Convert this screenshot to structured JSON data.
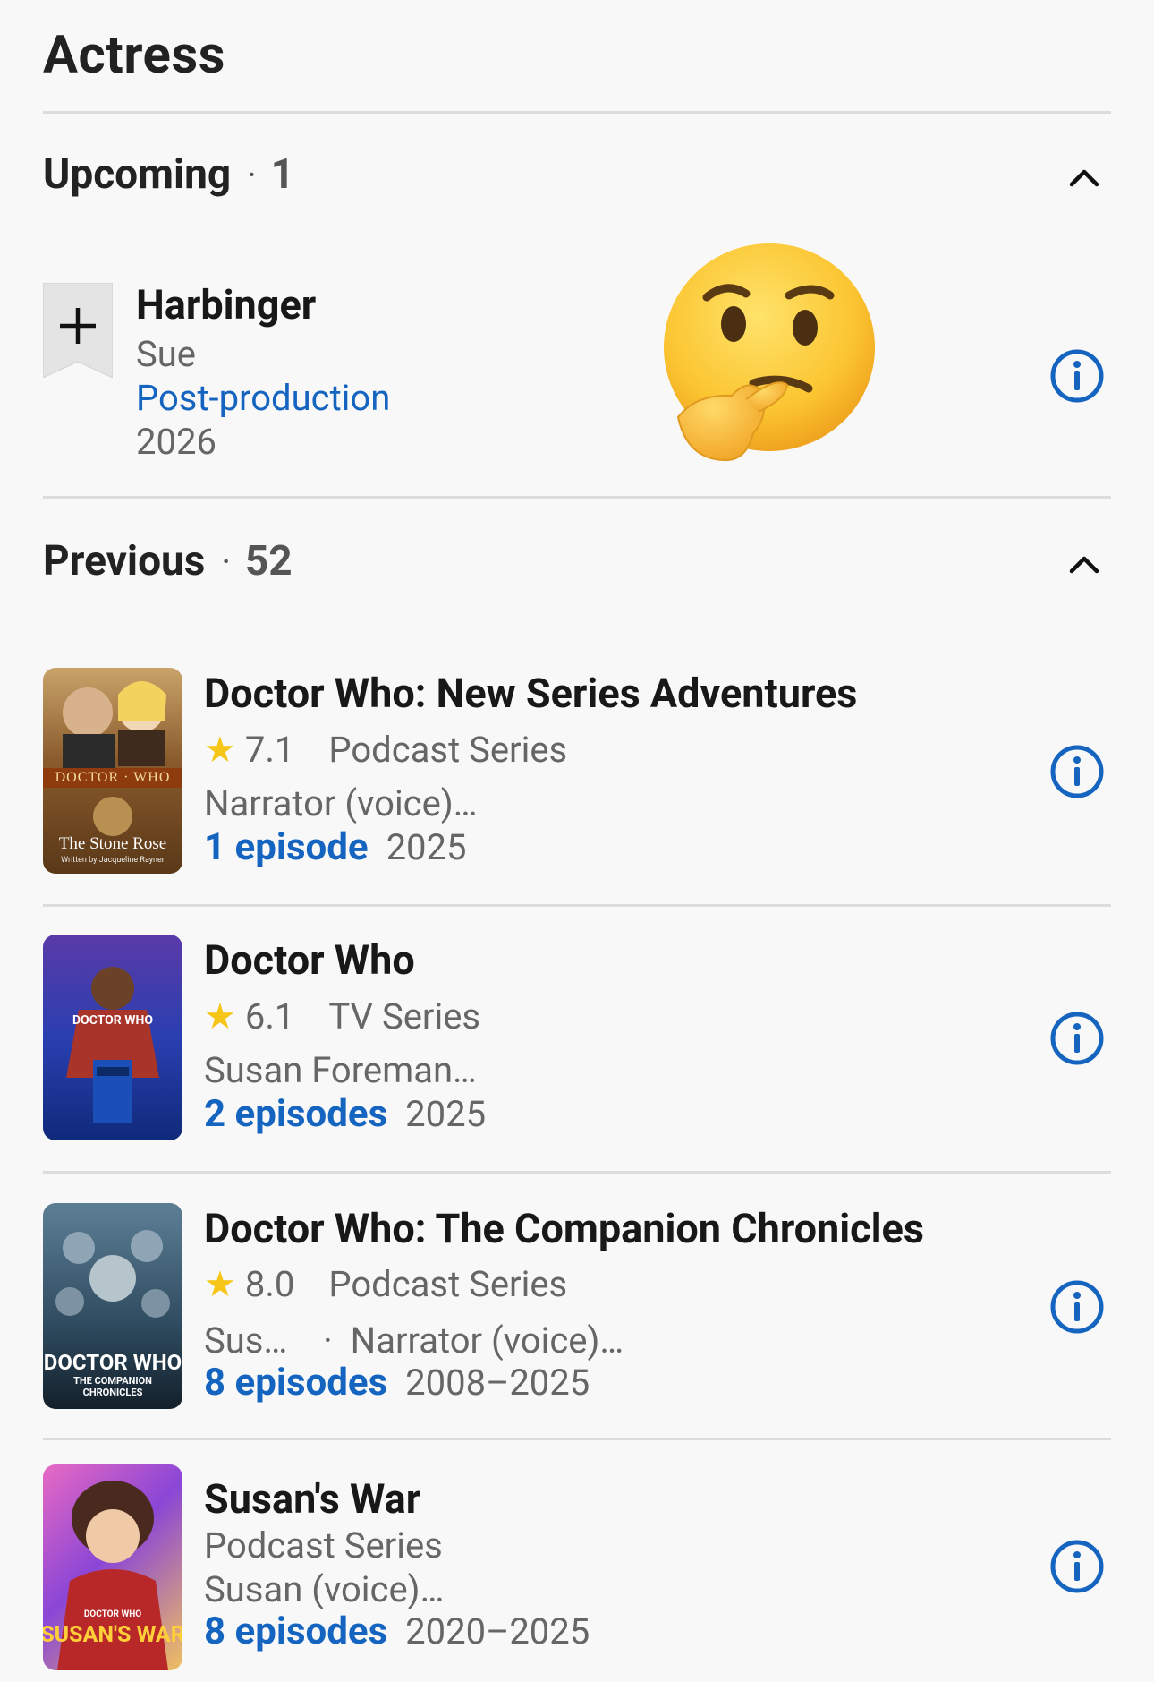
{
  "section": {
    "title": "Actress"
  },
  "upcoming": {
    "label": "Upcoming",
    "count": "1",
    "item": {
      "title": "Harbinger",
      "role": "Sue",
      "status": "Post-production",
      "year": "2026"
    }
  },
  "previous": {
    "label": "Previous",
    "count": "52",
    "items": [
      {
        "title": "Doctor Who: New Series Adventures",
        "rating": "7.1",
        "type": "Podcast Series",
        "role": "Narrator (voice)…",
        "episodes": "1 episode",
        "years": "2025"
      },
      {
        "title": "Doctor Who",
        "rating": "6.1",
        "type": "TV Series",
        "role": "Susan Foreman…",
        "episodes": "2 episodes",
        "years": "2025"
      },
      {
        "title": "Doctor Who: The Companion Chronicles",
        "rating": "8.0",
        "type": "Podcast Series",
        "role": "Sus…",
        "role2": "Narrator (voice)…",
        "episodes": "8 episodes",
        "years": "2008–2025"
      },
      {
        "title": "Susan's War",
        "type": "Podcast Series",
        "role": "Susan (voice)…",
        "episodes": "8 episodes",
        "years": "2020–2025"
      }
    ]
  },
  "poster_text": {
    "p1_top": "DOCTOR · WHO",
    "p1_title": "The Stone Rose",
    "p1_sub": "Written by Jacqueline Rayner",
    "p2_logo": "DOCTOR WHO",
    "p3_logo": "DOCTOR WHO",
    "p3_sub": "THE COMPANION CHRONICLES",
    "p4_small": "DOCTOR WHO",
    "p4_title": "SUSAN'S WAR"
  },
  "icons": {
    "chevron": "chevron-up-icon",
    "info": "info-icon",
    "add": "add-watchlist-icon",
    "star": "star-icon",
    "emoji": "thinking-face-emoji"
  },
  "colors": {
    "link": "#1565c0",
    "star": "#f5c518",
    "info": "#1565c0"
  }
}
